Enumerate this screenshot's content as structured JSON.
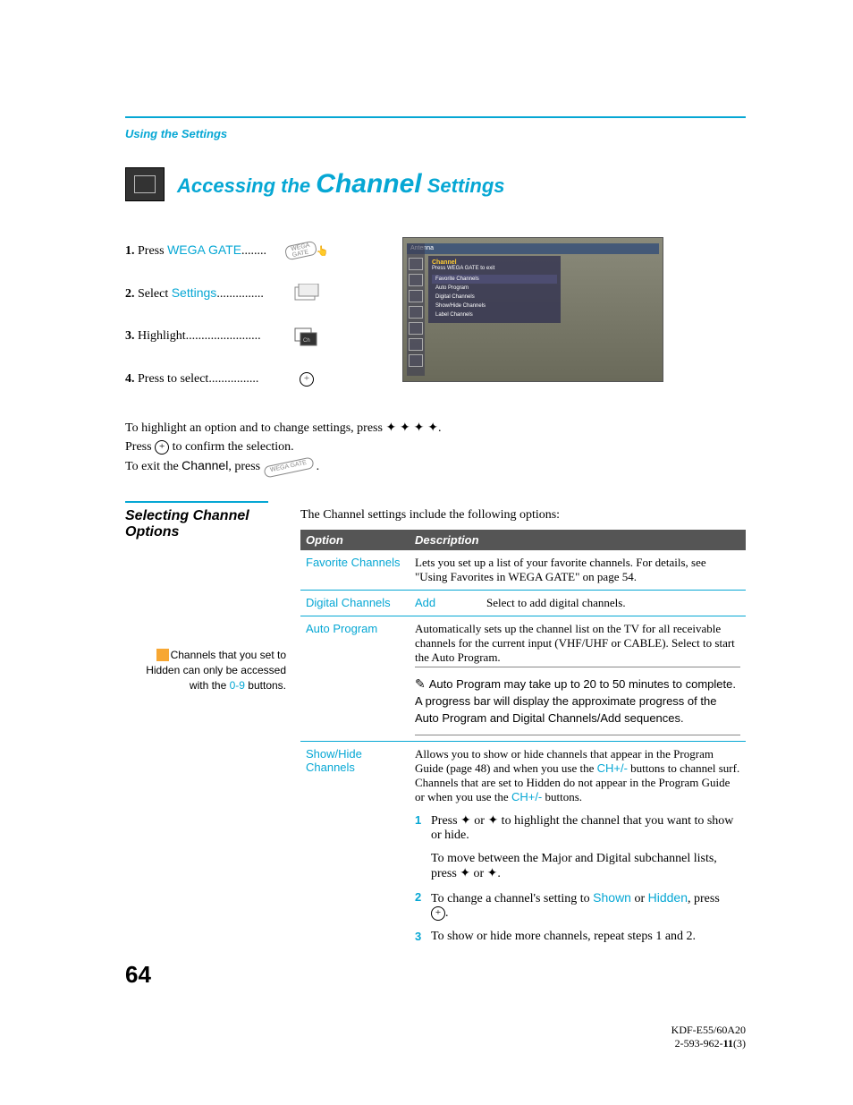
{
  "header": {
    "section": "Using the Settings",
    "title_pre": "Accessing the ",
    "title_big": "Channel",
    "title_post": " Settings"
  },
  "steps": [
    {
      "num": "1.",
      "action": "Press ",
      "target": "WEGA GATE",
      "dots": "........"
    },
    {
      "num": "2.",
      "action": "Select ",
      "target": "Settings",
      "dots": "..............."
    },
    {
      "num": "3.",
      "action": "Highlight",
      "target": "",
      "dots": "........................"
    },
    {
      "num": "4.",
      "action": "Press to select",
      "target": "",
      "dots": "................"
    }
  ],
  "osd": {
    "topbar": "Antenna",
    "title": "Channel",
    "subtitle": "Press WEGA GATE to exit",
    "items": [
      "Favorite Channels",
      "Auto Program",
      "Digital Channels",
      "Show/Hide Channels",
      "Label Channels"
    ]
  },
  "instructions": {
    "line1_a": "To highlight an option and to change settings, press ",
    "line1_arrows": "✦ ✦ ✦ ✦",
    "line1_b": ".",
    "line2_a": "Press ",
    "line2_b": " to confirm the selection.",
    "line3_a": "To exit the ",
    "line3_mid": "Channel",
    "line3_b": ", press ",
    "line3_c": "."
  },
  "left": {
    "heading": "Selecting Channel Options",
    "tip_a": "Channels that you set to Hidden can only be accessed with the ",
    "tip_link": "0-9",
    "tip_b": " buttons."
  },
  "table": {
    "intro": "The Channel settings include the following options:",
    "head_option": "Option",
    "head_desc": "Description",
    "favorite": {
      "name": "Favorite Channels",
      "desc": "Lets you set up a list of your favorite channels. For details, see \"Using Favorites in WEGA GATE\" on page 54."
    },
    "digital": {
      "name": "Digital Channels",
      "sub": "Add",
      "desc": "Select to add digital channels."
    },
    "auto": {
      "name": "Auto Program",
      "desc": "Automatically sets up the channel list on the TV for all receivable channels for the current input (VHF/UHF or CABLE). Select to start the Auto Program.",
      "note": "Auto Program may take up to 20 to 50 minutes to complete. A progress bar will display the approximate progress of the Auto Program and Digital Channels/Add sequences."
    },
    "showhide": {
      "name": "Show/Hide Channels",
      "desc_a": "Allows you to show or hide channels that appear in the Program Guide (page 48) and when you use the ",
      "desc_link1": "CH+/-",
      "desc_b": " buttons to channel surf. Channels that are set to Hidden do not appear in the Program Guide or when you use the ",
      "desc_link2": "CH+/-",
      "desc_c": " buttons.",
      "s1_num": "1",
      "s1_a": "Press ✦ or ✦ to highlight the channel that you want to show or hide.",
      "s1_sub": "To move between the Major and Digital subchannel lists, press ✦ or ✦.",
      "s2_num": "2",
      "s2_a": "To change a channel's setting to ",
      "s2_shown": "Shown",
      "s2_b": " or ",
      "s2_hidden": "Hidden",
      "s2_c": ", press ",
      "s2_d": ".",
      "s3_num": "3",
      "s3_a": "To show or hide more channels, repeat steps 1 and 2."
    }
  },
  "page_number": "64",
  "footer": {
    "model": "KDF-E55/60A20",
    "doc_a": "2-593-962-",
    "doc_b": "11",
    "doc_c": "(3)"
  }
}
